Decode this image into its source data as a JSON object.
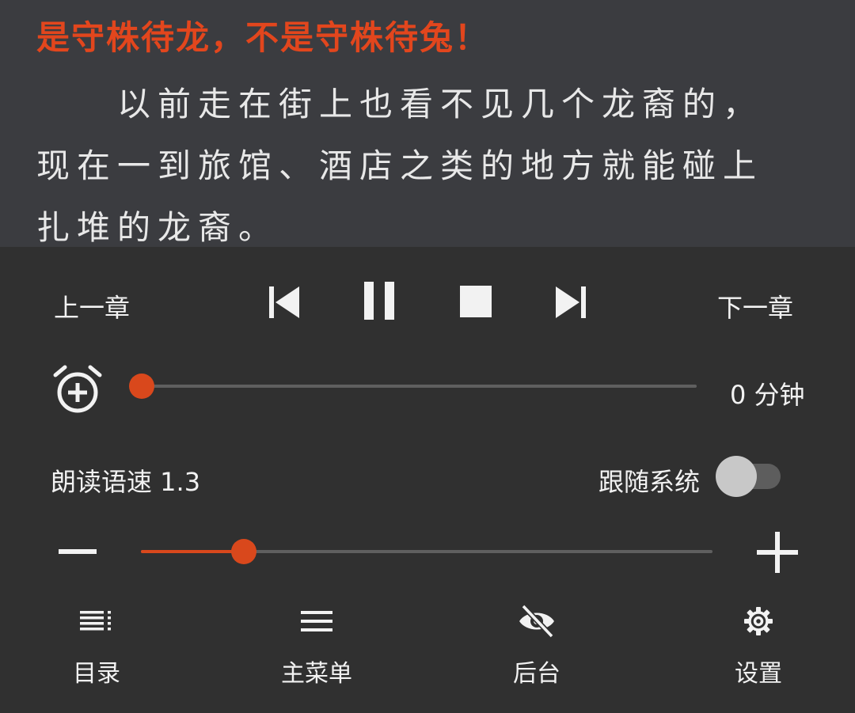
{
  "reader": {
    "chapter_title": "是守株待龙，不是守株待兔！",
    "lines": [
      "　　以前走在街上也看不见几个龙裔的，",
      "现在一到旅馆、酒店之类的地方就能碰上",
      "扎堆的龙裔。"
    ]
  },
  "playback": {
    "prev_chapter": "上一章",
    "next_chapter": "下一章"
  },
  "timer": {
    "value_label": "0 分钟",
    "minutes": 0
  },
  "speed": {
    "label": "朗读语速 1.3",
    "follow_system_label": "跟随系统",
    "follow_system_on": false,
    "slider_fraction": 0.18
  },
  "bottom_nav": {
    "toc": "目录",
    "main_menu": "主菜单",
    "background": "后台",
    "settings": "设置"
  },
  "colors": {
    "accent": "#d9481c",
    "title": "#e2461d",
    "reader_bg": "#3b3c40",
    "panel_bg": "#303030"
  },
  "icons": [
    "skip-previous-icon",
    "pause-icon",
    "stop-icon",
    "skip-next-icon",
    "alarm-add-icon",
    "minus-icon",
    "plus-icon",
    "toc-icon",
    "menu-icon",
    "eye-off-icon",
    "gear-icon"
  ]
}
